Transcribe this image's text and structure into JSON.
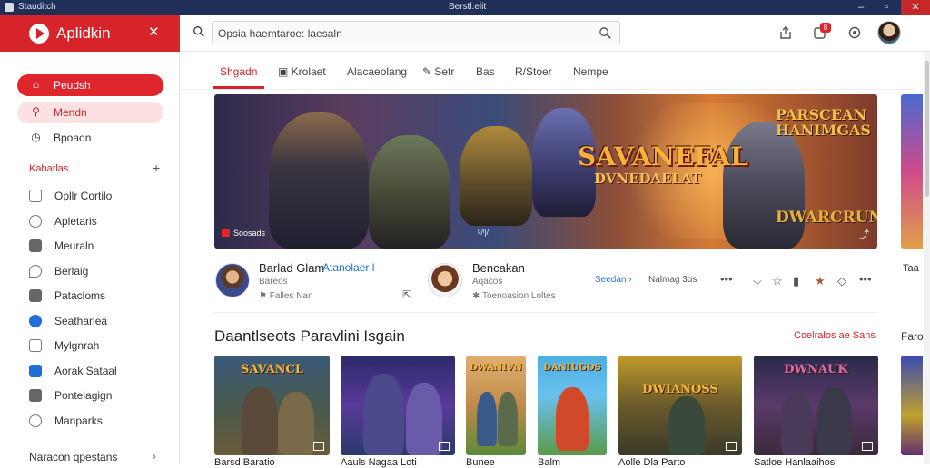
{
  "window": {
    "app_name": "Stauditch",
    "title": "Berstl.elit"
  },
  "brand": {
    "name": "Aplidkin"
  },
  "search": {
    "placeholder": "Opsia haemtaroe:  laesaln"
  },
  "notifications": {
    "count": "8"
  },
  "sidebar": {
    "nav": [
      {
        "label": "Peudsh",
        "icon": "home-icon"
      },
      {
        "label": "Mendn",
        "icon": "search-icon"
      },
      {
        "label": "Bpoaon",
        "icon": "clock-icon"
      }
    ],
    "section_title": "Kabarlas",
    "library": [
      {
        "label": "Opllr Cortilo"
      },
      {
        "label": "Apletaris"
      },
      {
        "label": "Meuraln"
      },
      {
        "label": "Berlaig"
      },
      {
        "label": "Patacloms"
      },
      {
        "label": "Seatharlea"
      },
      {
        "label": "Mylgnrah"
      },
      {
        "label": "Aorak Sataal"
      },
      {
        "label": "Pontelagign"
      },
      {
        "label": "Manparks"
      }
    ],
    "footer": "Naracon qpestans"
  },
  "tabs": [
    "Shgadn",
    "Krolaet",
    "Alacaeolang",
    "Setr",
    "Bas",
    "R/Stoer",
    "Nempe"
  ],
  "hero": {
    "title": "SAVANEFAL",
    "subtitle": "DVNEDAELAT",
    "top_right_title": "PARSCEAN HANIMGAS",
    "bottom_right_title": "DWARCRUN",
    "bottom_left": "Soosads",
    "bottom_mid": "ᵍ/ˡ|/",
    "bottom_right_icon": "share-icon"
  },
  "meta": {
    "creator1": {
      "name": "Barlad Glam",
      "link": "Atanolaer l",
      "sub": "Bareos",
      "sub2": "Falles Nan"
    },
    "creator2": {
      "name": "Bencakan",
      "sub": "Aqacos",
      "sub2": "Toenoasion Loltes"
    },
    "chip": "Seedan ›",
    "views": "Nalmag  3ɑs",
    "more": "•••",
    "peek": "Taa"
  },
  "section": {
    "title": "Daantlseots Paravlini Isgain",
    "see_all": "Coelralos ae Sans",
    "peek_title": "Faro"
  },
  "thumbs": [
    {
      "title": "SAVANCL",
      "caption": "Barsd Baratio"
    },
    {
      "title": "",
      "caption": "Aauls Nagaa Loti"
    },
    {
      "title": "DWANIVN",
      "caption": "Bunee"
    },
    {
      "title": "DANIUGOS",
      "caption": "Balm"
    },
    {
      "title": "DWIANOSS",
      "caption": "Aolle Dla Parto"
    },
    {
      "title": "DWNAUK",
      "caption": "Satloe Hanlaaihos"
    }
  ],
  "colors": {
    "brand_red": "#d7232a",
    "link_blue": "#1f6fd6",
    "titlebar": "#1f2f57"
  }
}
